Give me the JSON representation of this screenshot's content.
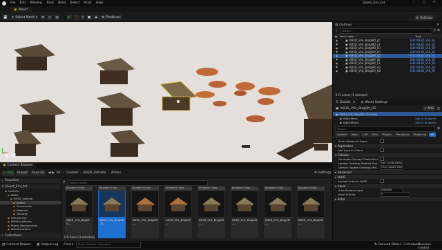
{
  "window": {
    "app_menu": [
      "File",
      "Edit",
      "Window",
      "Tools",
      "Build",
      "Select",
      "Actor",
      "Help"
    ],
    "title": "Quest_Env_tut",
    "map_tab": "Main*"
  },
  "toolbar": {
    "select_mode": "Select Mode",
    "platforms": "Platforms",
    "settings": "Settings"
  },
  "viewport": {
    "perspective": "Perspective",
    "lit": "Lit",
    "show": "Show",
    "grid_snap": "10",
    "rot_snap": "10°",
    "scale_snap": "0.25",
    "cam_speed": "4",
    "transform_hint": "E, W"
  },
  "outliner": {
    "title": "Outliner",
    "search_placeholder": "Search...",
    "col_label": "Item Label",
    "col_type": "Type",
    "rows": [
      {
        "label": "KB3D_VHL_BldgMD_J2",
        "type": "Edit KB3D_VHL_Bl",
        "sel": false
      },
      {
        "label": "KB3D_VHL_BldgMD_J3",
        "type": "Edit KB3D_VHL_Bl",
        "sel": false
      },
      {
        "label": "KB3D_VHL_BldgMD_B1",
        "type": "Edit KB3D_VHL_Bl",
        "sel": false
      },
      {
        "label": "KB3D_VHL_BldgSM_D1",
        "type": "Edit KB3D_VHL_Bl",
        "sel": false
      },
      {
        "label": "KB3D_VHL_BldgSM_D2",
        "type": "Edit KB3D_VHL_Bl",
        "sel": true
      },
      {
        "label": "KB3D_VHL_BldgSM_E2",
        "type": "Edit KB3D_VHL_Bl",
        "sel": false
      },
      {
        "label": "KB3D_VHL_BldgSM_F1",
        "type": "Edit KB3D_VHL_Bl",
        "sel": false
      },
      {
        "label": "KB3D_VHL_BldgSM_G2",
        "type": "Edit KB3D_VHL_Bl",
        "sel": false
      },
      {
        "label": "KB3D_VHL_BldgSM_H2",
        "type": "Edit KB3D_VHL_Bl",
        "sel": false
      }
    ],
    "count": "213 actors (1 selected)"
  },
  "details": {
    "tabs": [
      "Details",
      "World Settings"
    ],
    "actor_name": "KB3D_VHL_BldgSM_D2",
    "add_label": "+ Add",
    "components": [
      {
        "label": "KB3D_VHL_BldgSM_D2 (Self)",
        "type": ""
      },
      {
        "label": "StaticMesh",
        "type": "Edit in Blueprint"
      },
      {
        "label": "StaticMesh1",
        "type": "Edit in Blueprint"
      }
    ],
    "search_placeholder": "Search",
    "filter_tabs": [
      "General",
      "Actor",
      "LOD",
      "Misc",
      "Physics",
      "Rendering",
      "Streaming",
      "All"
    ],
    "sections": [
      {
        "title": "",
        "props": [
          {
            "name": "Actor Hidden In Game",
            "kind": "check",
            "value": ""
          }
        ]
      },
      {
        "title": "Replication",
        "props": [
          {
            "name": "Net Load on Client",
            "kind": "check",
            "value": ""
          }
        ]
      },
      {
        "title": "Collision",
        "props": [
          {
            "name": "Generate Overlap Events Duri...",
            "kind": "check",
            "value": ""
          },
          {
            "name": "Update Overlaps Method Duri...",
            "kind": "select",
            "value": "Use Config Default"
          },
          {
            "name": "Default Update Overlaps Met...",
            "kind": "select",
            "value": "Only Update Movable"
          }
        ]
      },
      {
        "title": "Advanced",
        "props": []
      },
      {
        "title": "HLOD",
        "props": [
          {
            "name": "Include Actor in HLOD",
            "kind": "check",
            "value": ""
          }
        ]
      },
      {
        "title": "Input",
        "props": [
          {
            "name": "Auto Receive Input",
            "kind": "select",
            "value": "Disabled"
          },
          {
            "name": "Input Priority",
            "kind": "text",
            "value": "0"
          }
        ]
      },
      {
        "title": "Actor",
        "props": []
      }
    ]
  },
  "content_browser": {
    "tabs": [
      "Content Browser",
      "Output Log"
    ],
    "add": "+ Add",
    "import": "Import",
    "save_all": "Save All",
    "breadcrumb": [
      "All",
      "Content",
      "KB3D_Valhalla",
      "Actors"
    ],
    "settings": "Settings",
    "search_placeholder": "Search Actors",
    "favorites": "Favorites",
    "project": "Quest_Env_tut",
    "tree": [
      {
        "label": "Content",
        "indent": 1,
        "sel": false
      },
      {
        "label": "KB3D",
        "indent": 2,
        "sel": false
      },
      {
        "label": "KB3D_Valhalla",
        "indent": 3,
        "sel": false
      },
      {
        "label": "Actors",
        "indent": 4,
        "sel": true
      },
      {
        "label": "Geometries",
        "indent": 4,
        "sel": false
      },
      {
        "label": "Materials",
        "indent": 4,
        "sel": false
      },
      {
        "label": "Textures",
        "indent": 4,
        "sel": false
      },
      {
        "label": "KMCommon",
        "indent": 2,
        "sel": false
      },
      {
        "label": "MMStructBasics",
        "indent": 2,
        "sel": false
      },
      {
        "label": "PixelA_Backgrounds",
        "indent": 2,
        "sel": false
      },
      {
        "label": "StarterContent",
        "indent": 2,
        "sel": false
      }
    ],
    "collections": "Collections",
    "assets": [
      {
        "type": "Blueprint Class",
        "name": "KB3D_VHL_BldgMD_...",
        "sel": false
      },
      {
        "type": "Blueprint Class",
        "name": "KB3D_VHL_BldgSM_D...",
        "sel": true
      },
      {
        "type": "Blueprint Class",
        "name": "KB3D_VHL_BldgSM_...",
        "sel": false
      },
      {
        "type": "Blueprint Class",
        "name": "KB3D_VHL_BldgSM_...",
        "sel": false
      },
      {
        "type": "Blueprint Class",
        "name": "KB3D_VHL_BldgSM_...",
        "sel": false
      },
      {
        "type": "Blueprint Class",
        "name": "KB3D_VHL_BldgSM_...",
        "sel": false
      },
      {
        "type": "Blueprint Class",
        "name": "KB3D_VHL_BldgSM_...",
        "sel": false
      },
      {
        "type": "Blueprint Class",
        "name": "KB3D_VHL_BldgSM_...",
        "sel": false
      }
    ],
    "count": "110 items (1 selected)"
  },
  "statusbar": {
    "content_drawer": "Content Drawer",
    "output_log": "Output Log",
    "cmd": "Cmd",
    "console_placeholder": "Enter Console Command",
    "derived": "Derived Data",
    "unsaved": "3 Unsaved",
    "revision": "Revision Control"
  },
  "colors": {
    "accent": "#1f6fd1",
    "play": "#35b33a",
    "selected_row": "#2d5a96"
  }
}
